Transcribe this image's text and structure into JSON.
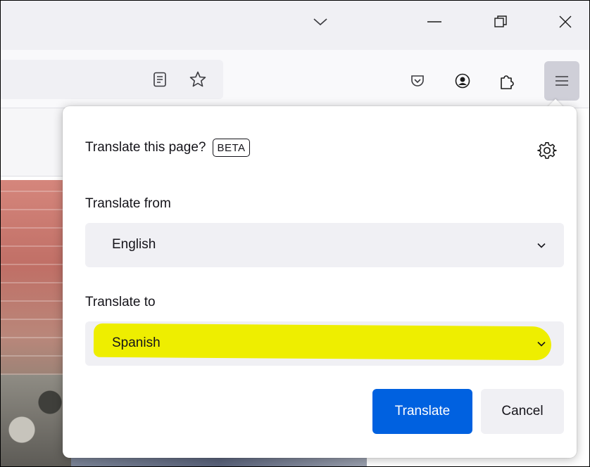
{
  "window": {
    "controls": [
      "tab-list",
      "minimize",
      "restore",
      "close"
    ]
  },
  "toolbar": {
    "icons": [
      "reader-view-icon",
      "bookmark-star-icon",
      "pocket-icon",
      "account-icon",
      "extensions-icon",
      "hamburger-menu-icon"
    ]
  },
  "panel": {
    "title": "Translate this page?",
    "badge": "BETA",
    "from_label": "Translate from",
    "from_value": "English",
    "to_label": "Translate to",
    "to_value": "Spanish",
    "highlight_color": "#eeee00",
    "translate_label": "Translate",
    "cancel_label": "Cancel",
    "primary_color": "#0061e0"
  }
}
